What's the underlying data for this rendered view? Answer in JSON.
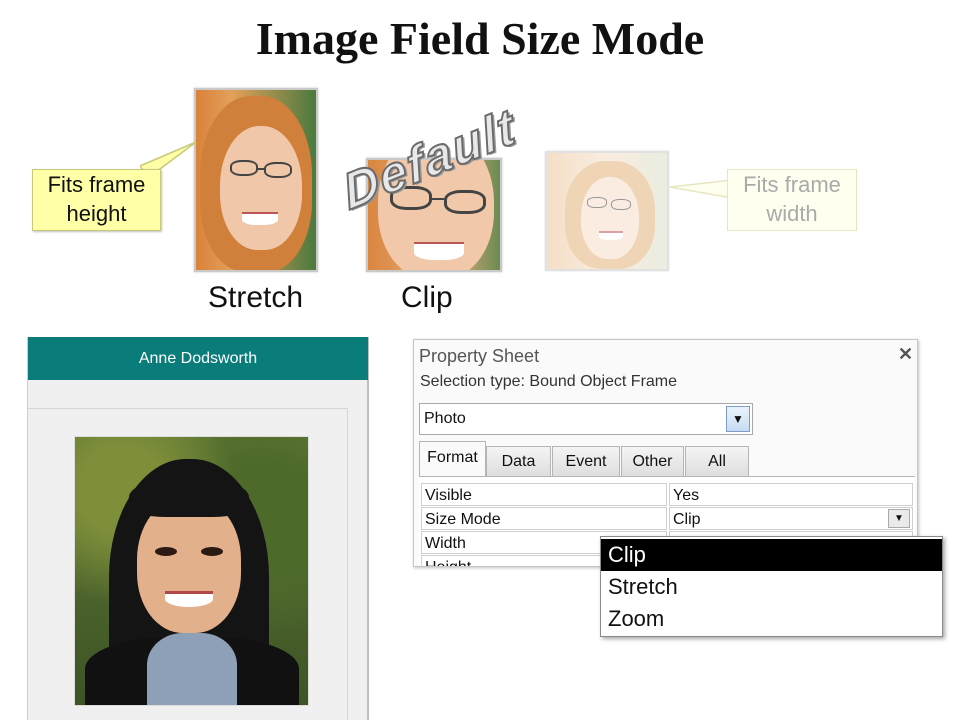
{
  "slide": {
    "title": "Image Field Size Mode",
    "default_label": "Default",
    "callout_left": "Fits frame\nheight",
    "callout_left_line1": "Fits frame",
    "callout_left_line2": "height",
    "callout_right_line1": "Fits frame",
    "callout_right_line2": "width",
    "caption_stretch": "Stretch",
    "caption_clip": "Clip"
  },
  "form": {
    "header_name": "Anne Dodsworth"
  },
  "property_sheet": {
    "title": "Property Sheet",
    "close_glyph": "✕",
    "selection_type": "Selection type:  Bound Object Frame",
    "object_combo_value": "Photo",
    "tabs": [
      "Format",
      "Data",
      "Event",
      "Other",
      "All"
    ],
    "active_tab": "Format",
    "rows": [
      {
        "name": "Visible",
        "value": "Yes"
      },
      {
        "name": "Size Mode",
        "value": "Clip"
      },
      {
        "name": "Width",
        "value": ""
      },
      {
        "name": "Height",
        "value": ""
      }
    ]
  },
  "size_mode_dropdown": {
    "options": [
      "Clip",
      "Stretch",
      "Zoom"
    ],
    "selected": "Clip"
  },
  "colors": {
    "form_header": "#0a7d7a",
    "callout": "#ffffa8",
    "dropdown_selected": "#000000"
  }
}
